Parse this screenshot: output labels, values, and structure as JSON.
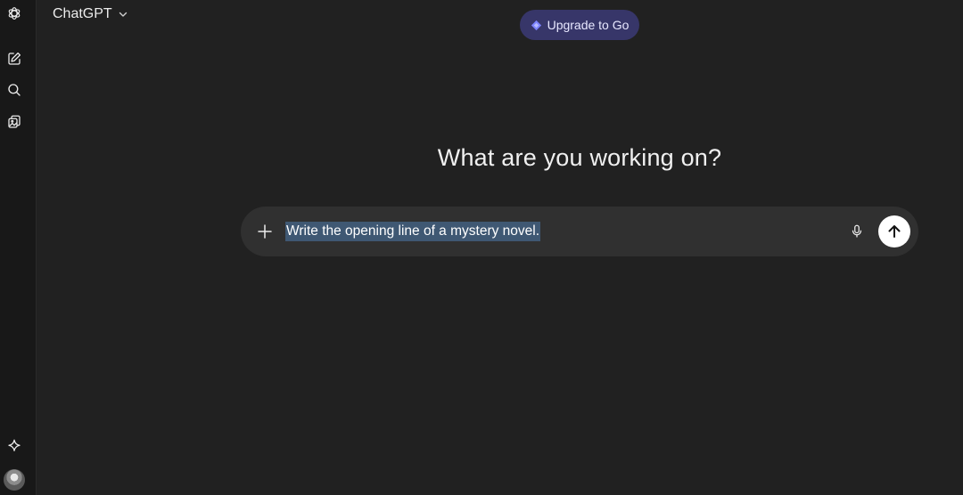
{
  "header": {
    "model_name": "ChatGPT",
    "upgrade_label": "Upgrade to Go"
  },
  "sidebar": {
    "items": [
      {
        "icon": "openai-logo-icon"
      },
      {
        "icon": "new-chat-icon"
      },
      {
        "icon": "search-icon"
      },
      {
        "icon": "library-icon"
      },
      {
        "icon": "sparkle-icon"
      },
      {
        "icon": "avatar"
      }
    ]
  },
  "main": {
    "heading": "What are you working on?"
  },
  "composer": {
    "value": "Write the opening line of a mystery novel.",
    "add_icon": "plus-icon",
    "mic_icon": "microphone-icon",
    "send_icon": "arrow-up-icon"
  },
  "colors": {
    "background": "#212121",
    "rail": "#181818",
    "composer": "#303030",
    "upgrade_pill": "#373669",
    "upgrade_accent": "#7c83ff",
    "selection": "#3f5873"
  }
}
